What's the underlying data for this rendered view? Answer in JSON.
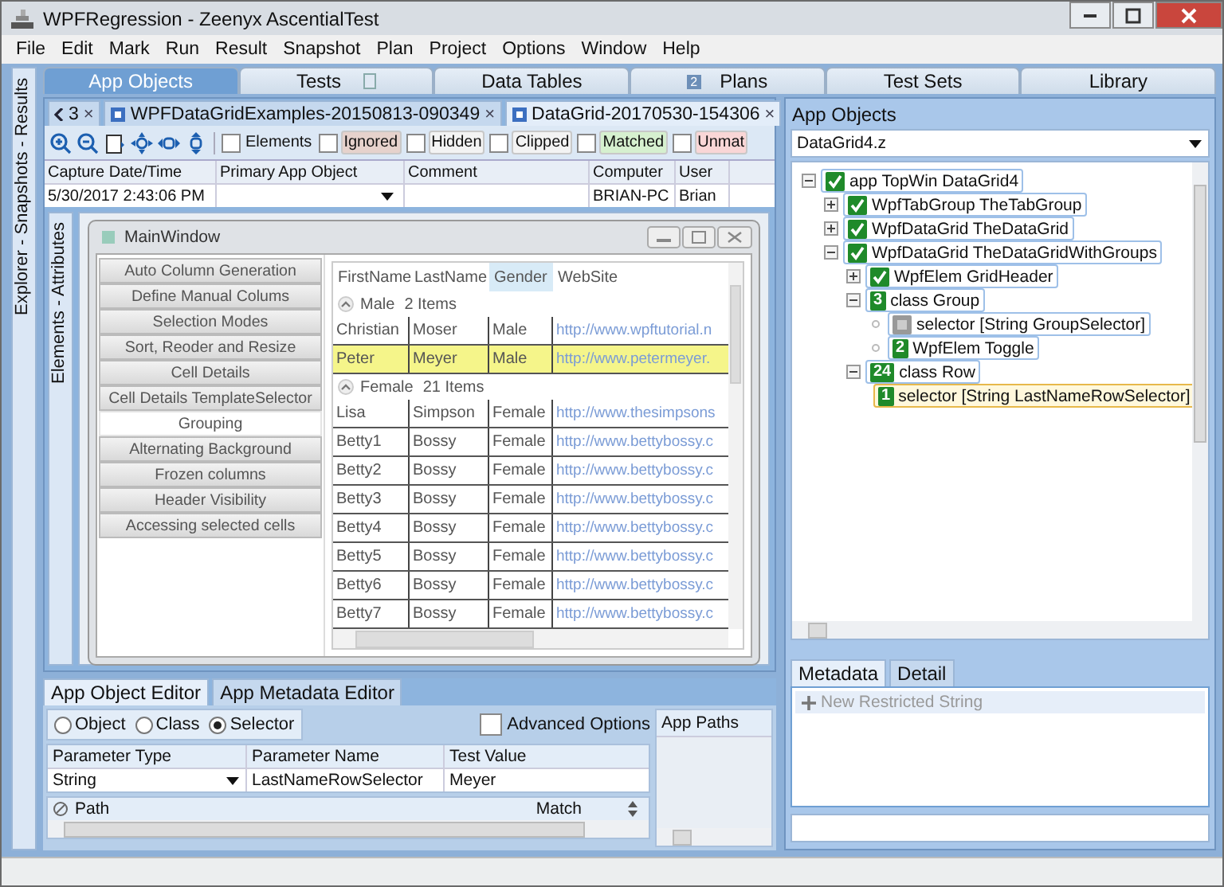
{
  "window": {
    "title": "WPFRegression - Zeenyx AscentialTest"
  },
  "menu": [
    "File",
    "Edit",
    "Mark",
    "Run",
    "Result",
    "Snapshot",
    "Plan",
    "Project",
    "Options",
    "Window",
    "Help"
  ],
  "side_strip": {
    "label": "Explorer - Snapshots - Results"
  },
  "main_tabs": [
    {
      "label": "App Objects",
      "selected": true
    },
    {
      "label": "Tests",
      "selected": false,
      "badge": {
        "kind": "blank"
      }
    },
    {
      "label": "Data Tables",
      "selected": false
    },
    {
      "label": "Plans",
      "selected": false,
      "badge": {
        "kind": "count",
        "text": "2"
      }
    },
    {
      "label": "Test Sets",
      "selected": false
    },
    {
      "label": "Library",
      "selected": false
    }
  ],
  "doc_tabs": [
    {
      "kind": "overflow",
      "label": "3",
      "close": "×"
    },
    {
      "kind": "doc",
      "label": "WPFDataGridExamples-20150813-090349",
      "close": "×",
      "selected": false
    },
    {
      "kind": "doc",
      "label": "DataGrid-20170530-154306",
      "close": "×",
      "selected": true
    }
  ],
  "filters": [
    {
      "label": "Elements",
      "checked": false
    },
    {
      "label": "Ignored",
      "checked": false,
      "color": "#e6d2cc"
    },
    {
      "label": "Hidden",
      "checked": false,
      "color": "#f3f3f3"
    },
    {
      "label": "Clipped",
      "checked": false,
      "color": "#f3f3f3"
    },
    {
      "label": "Matched",
      "checked": false,
      "color": "#d6f0cf"
    },
    {
      "label": "Unmat",
      "checked": false,
      "color": "#f9d6d6"
    }
  ],
  "snapshot_info": {
    "columns": [
      "Capture Date/Time",
      "Primary App Object",
      "Comment",
      "Computer",
      "User"
    ],
    "capture": "5/30/2017 2:43:06 PM",
    "computer": "BRIAN-PC",
    "user": "Brian"
  },
  "inner_strip": {
    "label": "Elements - Attributes"
  },
  "app_window": {
    "title": "MainWindow",
    "nav": [
      {
        "label": "Auto Column Generation",
        "selected": false
      },
      {
        "label": "Define Manual Colums",
        "selected": false
      },
      {
        "label": "Selection Modes",
        "selected": false
      },
      {
        "label": "Sort, Reoder and Resize",
        "selected": false
      },
      {
        "label": "Cell Details",
        "selected": false
      },
      {
        "label": "Cell Details TemplateSelector",
        "selected": false
      },
      {
        "label": "Grouping",
        "selected": true
      },
      {
        "label": "Alternating Background",
        "selected": false
      },
      {
        "label": "Frozen columns",
        "selected": false
      },
      {
        "label": "Header Visibility",
        "selected": false
      },
      {
        "label": "Accessing selected cells",
        "selected": false
      }
    ],
    "columns": [
      {
        "label": "FirstName",
        "selected": false
      },
      {
        "label": "LastName",
        "selected": false
      },
      {
        "label": "Gender",
        "selected": true
      },
      {
        "label": "WebSite",
        "selected": false
      }
    ],
    "groups": [
      {
        "name": "Male",
        "count": "2 Items",
        "expanded": true,
        "rows": [
          {
            "cells": [
              "Christian",
              "Moser",
              "Male",
              "http://www.wpftutorial.n"
            ],
            "highlighted": false
          },
          {
            "cells": [
              "Peter",
              "Meyer",
              "Male",
              "http://www.petermeyer."
            ],
            "highlighted": true
          }
        ]
      },
      {
        "name": "Female",
        "count": "21 Items",
        "expanded": true,
        "rows": [
          {
            "cells": [
              "Lisa",
              "Simpson",
              "Female",
              "http://www.thesimpsons"
            ],
            "highlighted": false
          },
          {
            "cells": [
              "Betty1",
              "Bossy",
              "Female",
              "http://www.bettybossy.c"
            ],
            "highlighted": false
          },
          {
            "cells": [
              "Betty2",
              "Bossy",
              "Female",
              "http://www.bettybossy.c"
            ],
            "highlighted": false
          },
          {
            "cells": [
              "Betty3",
              "Bossy",
              "Female",
              "http://www.bettybossy.c"
            ],
            "highlighted": false
          },
          {
            "cells": [
              "Betty4",
              "Bossy",
              "Female",
              "http://www.bettybossy.c"
            ],
            "highlighted": false
          },
          {
            "cells": [
              "Betty5",
              "Bossy",
              "Female",
              "http://www.bettybossy.c"
            ],
            "highlighted": false
          },
          {
            "cells": [
              "Betty6",
              "Bossy",
              "Female",
              "http://www.bettybossy.c"
            ],
            "highlighted": false
          },
          {
            "cells": [
              "Betty7",
              "Bossy",
              "Female",
              "http://www.bettybossy.c"
            ],
            "highlighted": false
          }
        ]
      }
    ]
  },
  "editor": {
    "tabs": [
      {
        "label": "App Object Editor",
        "selected": true
      },
      {
        "label": "App Metadata Editor",
        "selected": false
      }
    ],
    "modes": [
      {
        "label": "Object",
        "selected": false
      },
      {
        "label": "Class",
        "selected": false
      },
      {
        "label": "Selector",
        "selected": true
      }
    ],
    "advanced": {
      "label": "Advanced Options",
      "checked": false
    },
    "param_columns": [
      "Parameter Type",
      "Parameter Name",
      "Test Value"
    ],
    "param_row": {
      "type": "String",
      "name": "LastNameRowSelector",
      "value": "Meyer"
    },
    "path_columns": [
      "Path",
      "Match"
    ],
    "app_paths": "App Paths"
  },
  "explorer": {
    "title": "App Objects",
    "file": "DataGrid4.z",
    "tree": [
      {
        "label": "app TopWin DataGrid4",
        "kind": "check",
        "expanded": true,
        "selected": false,
        "children": [
          {
            "label": "WpfTabGroup TheTabGroup",
            "kind": "check",
            "expanded": false,
            "selected": false
          },
          {
            "label": "WpfDataGrid TheDataGrid",
            "kind": "check",
            "expanded": false,
            "selected": false
          },
          {
            "label": "WpfDataGrid TheDataGridWithGroups",
            "kind": "check",
            "expanded": true,
            "selected": false,
            "children": [
              {
                "label": "WpfElem GridHeader",
                "kind": "check",
                "expanded": false,
                "selected": false
              },
              {
                "label": "class Group",
                "kind": "count",
                "count": "3",
                "expanded": true,
                "selected": false,
                "children": [
                  {
                    "label": "selector [String GroupSelector]",
                    "kind": "blank",
                    "selected": false
                  },
                  {
                    "label": "WpfElem Toggle",
                    "kind": "count",
                    "count": "2",
                    "selected": false
                  }
                ]
              },
              {
                "label": "class Row",
                "kind": "count",
                "count": "24",
                "expanded": true,
                "selected": false,
                "children": [
                  {
                    "label": "selector [String LastNameRowSelector]",
                    "kind": "count",
                    "count": "1",
                    "selected": true
                  }
                ]
              }
            ]
          }
        ]
      }
    ]
  },
  "metadata": {
    "tabs": [
      {
        "label": "Metadata",
        "selected": true
      },
      {
        "label": "Detail",
        "selected": false
      }
    ],
    "new_item": "New Restricted String"
  }
}
